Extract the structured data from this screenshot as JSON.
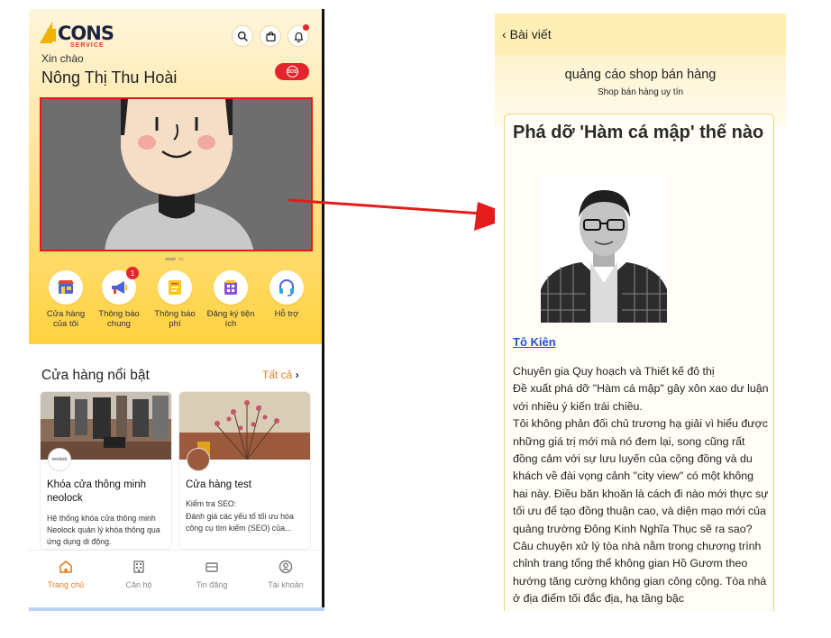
{
  "left": {
    "logo": {
      "text": "CONS",
      "sub": "SERVICE"
    },
    "greeting": "Xin chào",
    "user_name": "Nông Thị Thu Hoài",
    "sos_label": "SOS",
    "quick_actions": [
      {
        "label": "Cửa hàng của tôi",
        "icon": "store-icon"
      },
      {
        "label": "Thông báo chung",
        "icon": "megaphone-icon",
        "badge": "1"
      },
      {
        "label": "Thông báo phí",
        "icon": "bill-icon"
      },
      {
        "label": "Đăng ký tiện ích",
        "icon": "building-icon"
      },
      {
        "label": "Hỗ trợ",
        "icon": "headset-icon"
      }
    ],
    "featured": {
      "title": "Cửa hàng nổi bật",
      "see_all": "Tất cả"
    },
    "stores": [
      {
        "avatar": "neolock",
        "title": "Khóa cửa thông minh neolock",
        "desc": "Hệ thống khóa cửa thông minh Neolock quản lý khóa thông qua ứng dụng di động."
      },
      {
        "title": "Cửa hàng test",
        "desc_line1": "Kiểm tra SEO:",
        "desc": "Đánh giá các yếu tố tối ưu hóa công cụ tìm kiếm (SEO) của..."
      }
    ],
    "nav": [
      {
        "label": "Trang chủ",
        "icon": "home-icon",
        "active": true
      },
      {
        "label": "Căn hộ",
        "icon": "apartment-icon"
      },
      {
        "label": "Tin đăng",
        "icon": "listing-icon"
      },
      {
        "label": "Tài khoản",
        "icon": "account-icon"
      }
    ],
    "colors": {
      "accent": "#e57b1f",
      "highlight": "#e81818",
      "yellow": "#ffd23f"
    }
  },
  "right": {
    "back_label": "Bài viết",
    "title": "quảng cáo shop bán hàng",
    "subtitle": "Shop bán hàng uy tín",
    "article": {
      "heading": "Phá dỡ 'Hàm cá mập' thế nào",
      "author": "Tô Kiên",
      "paragraphs": [
        "Chuyên gia Quy hoạch và Thiết kế đô thị",
        "Đề xuất phá dỡ \"Hàm cá mập\" gây xôn xao dư luận với nhiều ý kiến trái chiều.",
        "Tôi không phản đối chủ trương hạ giải vì hiểu được những giá trị mới mà nó đem lại, song cũng rất đồng cảm với sự lưu luyến của cộng đồng và du khách về đài vọng cảnh \"city view\" có một không hai này. Điều băn khoăn là cách đi nào mới thực sự tối ưu để tạo đồng thuận cao, và diện mạo mới của quảng trường Đông Kinh Nghĩa Thục sẽ ra sao?",
        "Câu chuyện xử lý tòa nhà nằm trong chương trình chỉnh trang tổng thể không gian Hồ Gươm theo hướng tăng cường không gian công cộng. Tòa nhà ở địa điểm tối đắc địa, hạ tầng bậc"
      ]
    }
  }
}
